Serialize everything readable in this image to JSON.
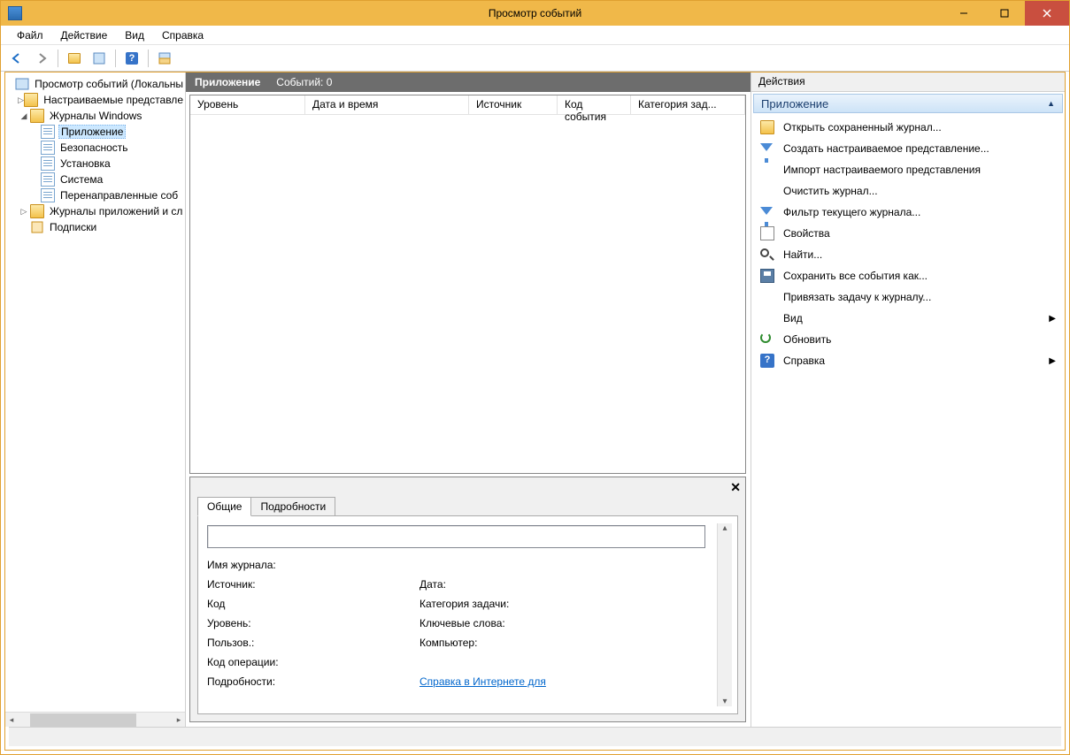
{
  "title": "Просмотр событий",
  "menu": {
    "file": "Файл",
    "action": "Действие",
    "view": "Вид",
    "help": "Справка"
  },
  "tree": {
    "root": "Просмотр событий (Локальны",
    "custom": "Настраиваемые представле",
    "winlogs": "Журналы Windows",
    "app": "Приложение",
    "security": "Безопасность",
    "setup": "Установка",
    "system": "Система",
    "forwarded": "Перенаправленные соб",
    "applogs": "Журналы приложений и сл",
    "subs": "Подписки"
  },
  "center": {
    "title": "Приложение",
    "count": "Событий: 0",
    "cols": {
      "level": "Уровень",
      "datetime": "Дата и время",
      "source": "Источник",
      "eventid": "Код события",
      "category": "Категория зад..."
    }
  },
  "details": {
    "tab_general": "Общие",
    "tab_details": "Подробности",
    "log_name": "Имя журнала:",
    "source": "Источник:",
    "date": "Дата:",
    "code": "Код",
    "task_cat": "Категория задачи:",
    "level": "Уровень:",
    "keywords": "Ключевые слова:",
    "user": "Пользов.:",
    "computer": "Компьютер:",
    "opcode": "Код операции:",
    "more": "Подробности:",
    "help_link": "Справка в Интернете для"
  },
  "actions": {
    "pane_title": "Действия",
    "section": "Приложение",
    "items": {
      "open_saved": "Открыть сохраненный журнал...",
      "create_view": "Создать настраиваемое представление...",
      "import_view": "Импорт настраиваемого представления",
      "clear": "Очистить журнал...",
      "filter": "Фильтр текущего журнала...",
      "props": "Свойства",
      "find": "Найти...",
      "save_all": "Сохранить все события как...",
      "attach_task": "Привязать задачу к журналу...",
      "view": "Вид",
      "refresh": "Обновить",
      "help": "Справка"
    }
  }
}
